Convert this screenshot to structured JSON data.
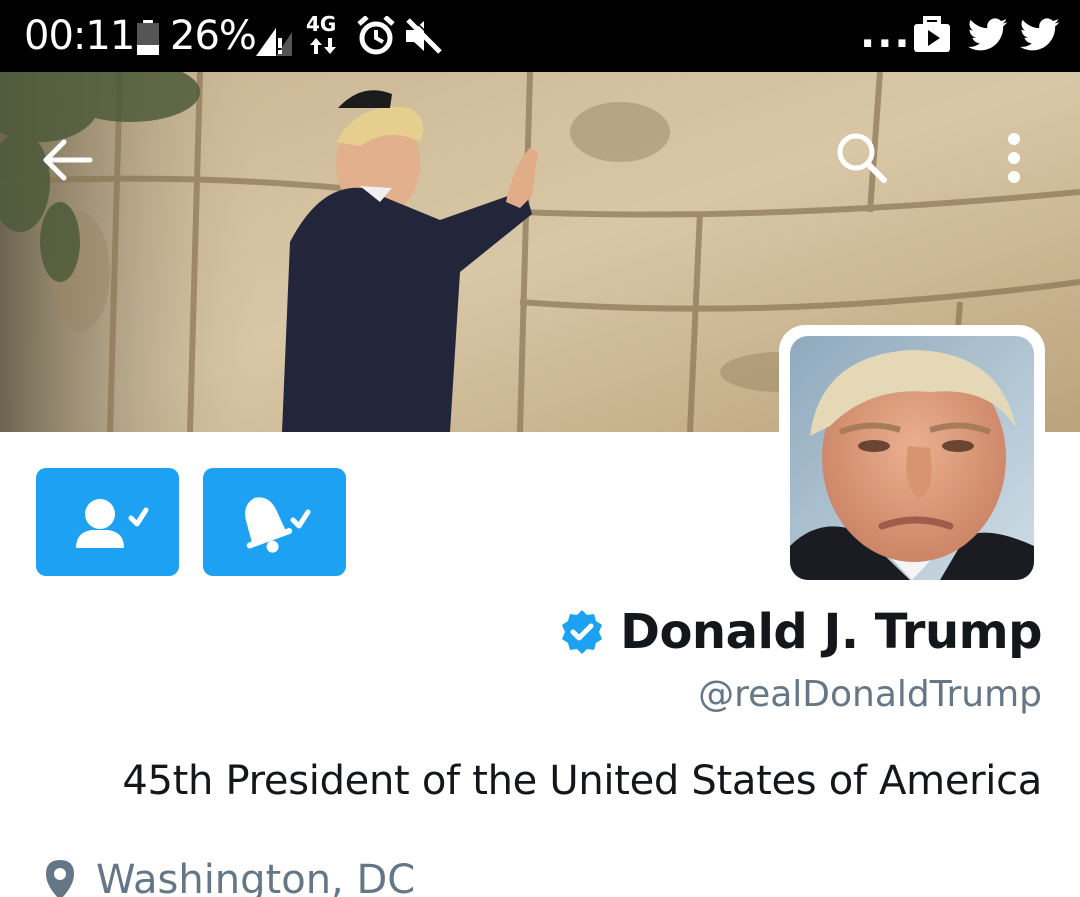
{
  "status_bar": {
    "time": "00:11",
    "battery_percent": "26%",
    "network": "4G",
    "overflow": "...",
    "icons": [
      "battery-icon",
      "signal-icon",
      "network-4g-icon",
      "alarm-icon",
      "mute-icon",
      "briefcase-icon",
      "twitter-icon",
      "twitter-icon"
    ]
  },
  "header": {
    "icons": [
      "back-arrow-icon",
      "search-icon",
      "more-vert-icon"
    ]
  },
  "actions": {
    "icons": [
      "following-user-check-icon",
      "notifications-on-bell-check-icon"
    ]
  },
  "profile": {
    "display_name": "Donald J. Trump",
    "handle": "@realDonaldTrump",
    "bio": "45th President of the United States of America",
    "location": "Washington, DC",
    "verified": true
  },
  "colors": {
    "accent": "#1da1f2",
    "text_primary": "#14171a",
    "text_secondary": "#657786",
    "status_bar_bg": "#000000"
  }
}
